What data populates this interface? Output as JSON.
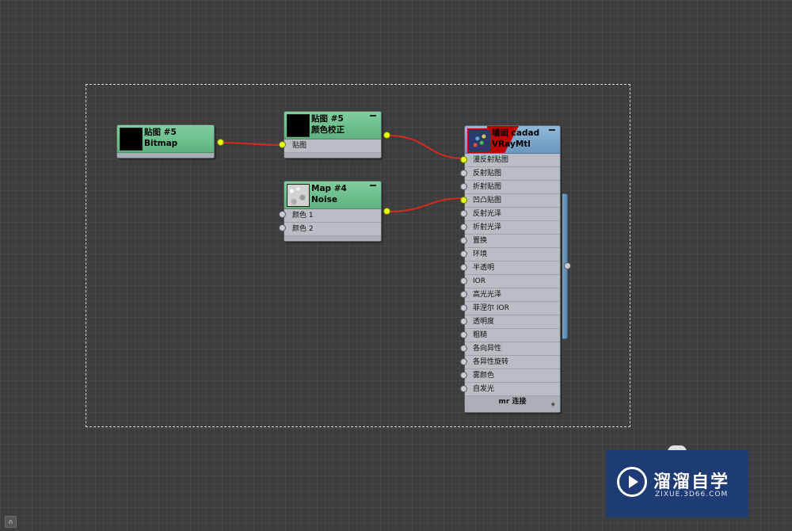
{
  "editor": {
    "nodes": {
      "bitmap": {
        "title_line1": "贴图 #5",
        "title_line2": "Bitmap"
      },
      "color_correct": {
        "title_line1": "贴图 #5",
        "title_line2": "颜色校正",
        "slots": [
          "贴图"
        ]
      },
      "noise": {
        "title_line1": "Map #4",
        "title_line2": "Noise",
        "slots": [
          "颜色 1",
          "颜色 2"
        ]
      },
      "vray": {
        "title_line1": "墙面 cadad",
        "title_line2": "VRayMtl",
        "slots": [
          "漫反射贴图",
          "反射贴图",
          "折射贴图",
          "凹凸贴图",
          "反射光泽",
          "折射光泽",
          "置换",
          "环境",
          "半透明",
          "IOR",
          "高光光泽",
          "菲涅尔 IOR",
          "透明度",
          "粗糙",
          "各向异性",
          "各异性旋转",
          "雾颜色",
          "自发光"
        ],
        "connected_slots": [
          "漫反射贴图",
          "凹凸贴图"
        ],
        "footer": "mr 连接"
      }
    },
    "wire_color": "#d42a1e",
    "active_port_color": "#e8ff1a"
  },
  "watermark": {
    "name": "溜溜自学",
    "url": "ZIXUE.3D66.COM",
    "background": "#1e3b73",
    "icon": "play-circle-icon"
  }
}
